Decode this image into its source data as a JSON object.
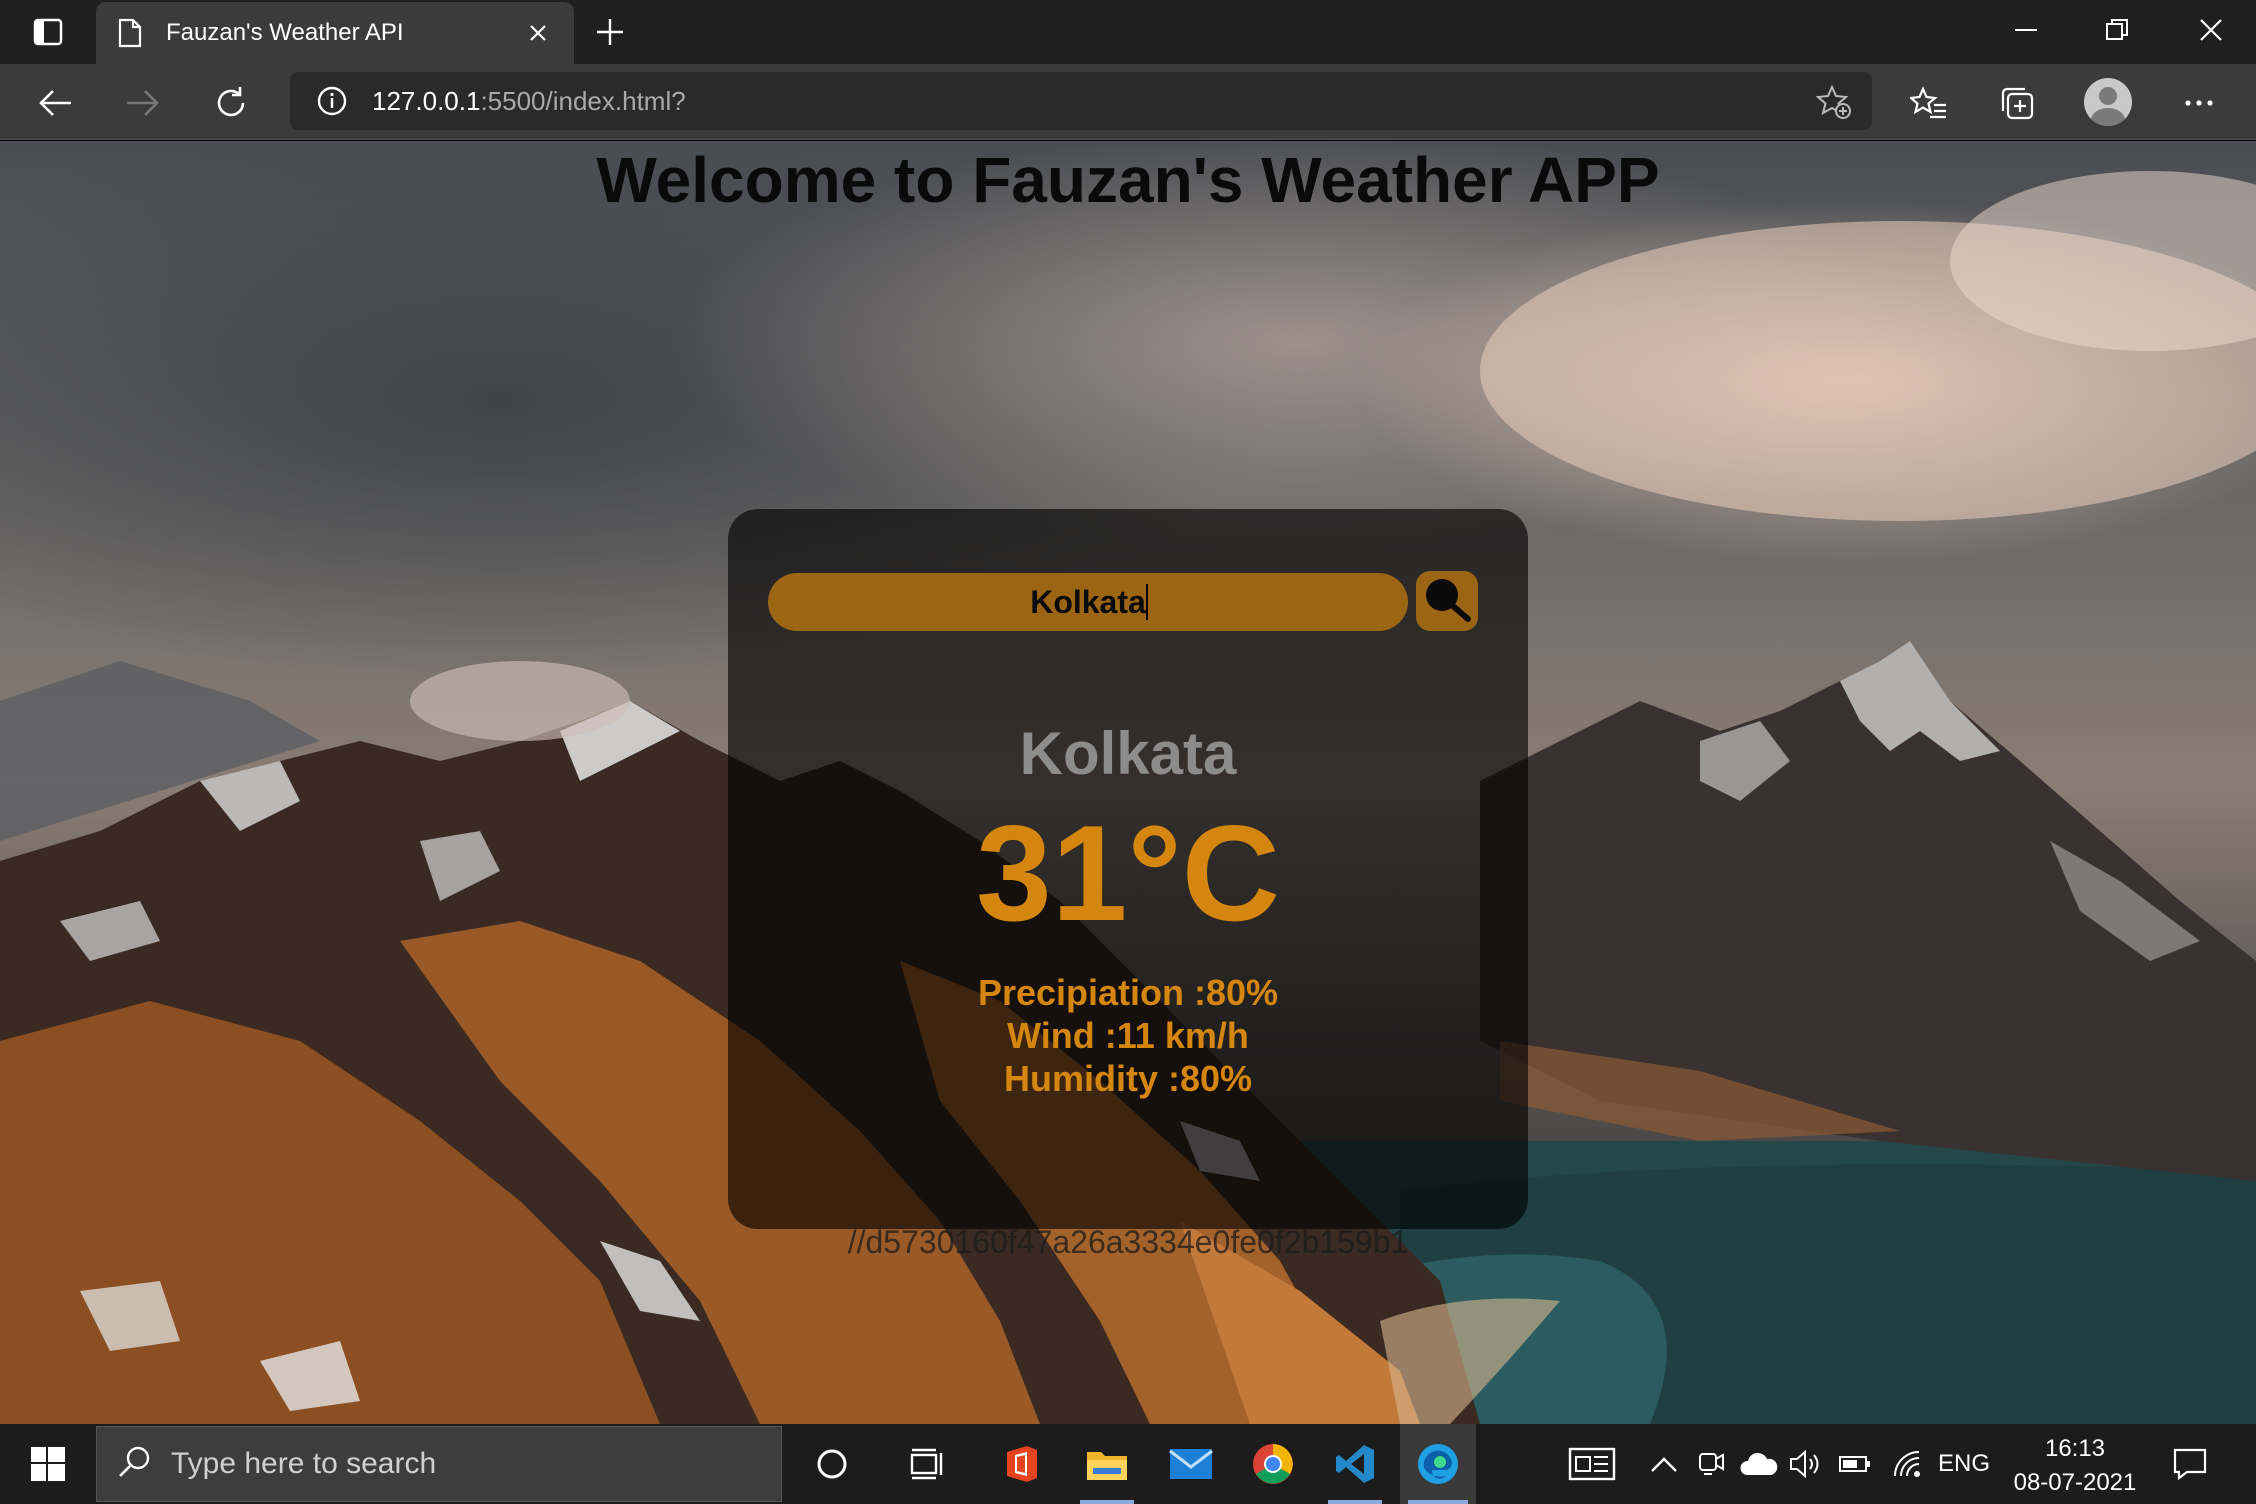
{
  "browser": {
    "tab_title": "Fauzan's Weather API",
    "url_host": "127.0.0.1",
    "url_rest": ":5500/index.html?"
  },
  "page": {
    "heading": "Welcome to Fauzan's Weather APP",
    "search_value": "Kolkata",
    "city": "Kolkata",
    "temperature": "31°C",
    "precipitation": "Precipiation :80%",
    "wind": "Wind :11 km/h",
    "humidity": "Humidity :80%",
    "api_key_text": "//d5730160f47a26a3334e0fe0f2b159b1"
  },
  "taskbar": {
    "search_placeholder": "Type here to search",
    "language": "ENG",
    "time": "16:13",
    "date": "08-07-2021"
  },
  "colors": {
    "accent_orange": "#d4860e",
    "input_bg": "#9b6514",
    "card_bg": "rgba(0,0,0,0.62)"
  }
}
